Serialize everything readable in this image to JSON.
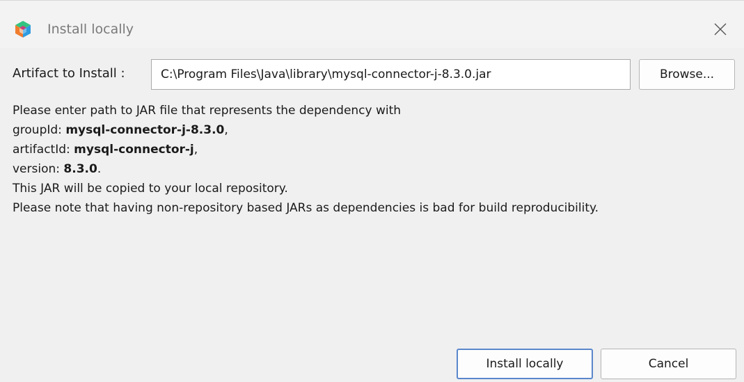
{
  "window": {
    "title": "Install locally"
  },
  "artifact": {
    "label": "Artifact to Install :",
    "path": "C:\\Program Files\\Java\\library\\mysql-connector-j-8.3.0.jar",
    "browse_label": "Browse..."
  },
  "description": {
    "line1": "Please enter path to JAR file that represents the dependency with",
    "group_key": "groupId: ",
    "group_value": "mysql-connector-j-8.3.0",
    "artifact_key": "artifactId: ",
    "artifact_value": "mysql-connector-j",
    "version_key": "version: ",
    "version_value": "8.3.0",
    "separator_comma": ",",
    "separator_period": ".",
    "line5": "This JAR will be copied to your local repository.",
    "line6": "Please note that having non-repository based JARs as dependencies is bad for build reproducibility."
  },
  "actions": {
    "install_label": "Install locally",
    "cancel_label": "Cancel"
  },
  "colors": {
    "default_button_border": "#5a86cc",
    "icon_green": "#33c481",
    "icon_orange": "#f07d2e",
    "icon_pink": "#d7337a",
    "icon_blue": "#2f9be0"
  },
  "icons": {
    "app": "netbeans-cube-icon",
    "close": "close-icon"
  }
}
